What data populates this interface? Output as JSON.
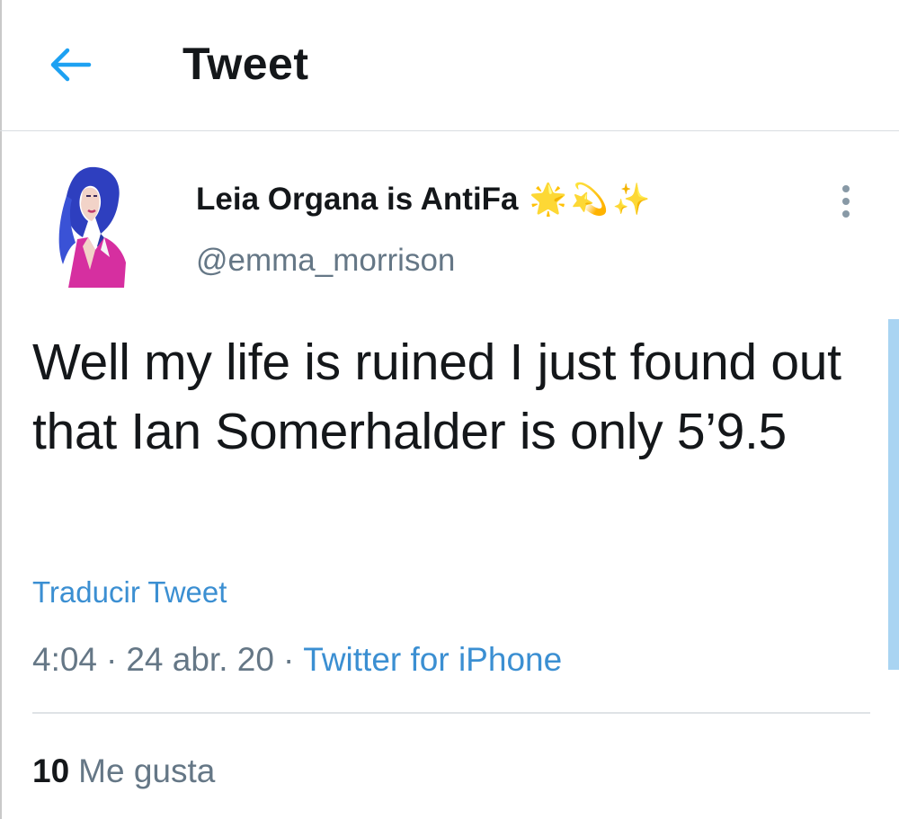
{
  "header": {
    "back_icon": "arrow-left-icon",
    "title": "Tweet",
    "accent_color": "#1da1f2"
  },
  "tweet": {
    "author": {
      "display_name": "Leia Organa is AntiFa",
      "name_emojis": [
        "🌟",
        "💫",
        "✨"
      ],
      "handle": "@emma_morrison",
      "avatar_icon": "avatar-portrait"
    },
    "more_icon": "vertical-ellipsis-icon",
    "text": "Well my life is ruined I just found out that Ian Somerhalder is only 5’9.5",
    "translate_label": "Traducir Tweet",
    "meta": {
      "time": "4:04",
      "date": "24 abr. 20",
      "separator": "·",
      "source": "Twitter for iPhone"
    },
    "stats": {
      "likes_count": "10",
      "likes_label": "Me gusta"
    }
  }
}
